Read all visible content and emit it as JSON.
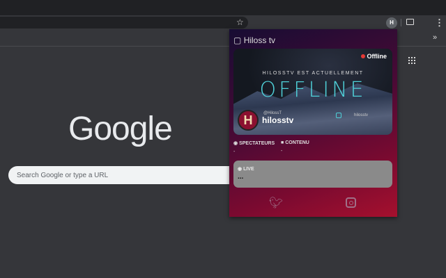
{
  "browser": {
    "search_placeholder": "Search Google or type a URL",
    "logo": "Google",
    "extension_label": "H"
  },
  "popup": {
    "title": "Hiloss tv",
    "status": "Offline",
    "banner_line": "HILOSSTV EST ACTUELLEMENT",
    "banner_big": "OFFLINE",
    "twitter_handle": "@HilossT",
    "instagram_handle": "hilosstv",
    "channel_name": "hilosstv",
    "avatar_letter": "H",
    "viewers_label": "SPECTATEURS",
    "viewers_value": "-",
    "content_label": "CONTENU",
    "content_value": "-",
    "live_label": "LIVE",
    "live_value": "..."
  },
  "colors": {
    "accent": "#4fd1d9",
    "offline_dot": "#e53935"
  }
}
